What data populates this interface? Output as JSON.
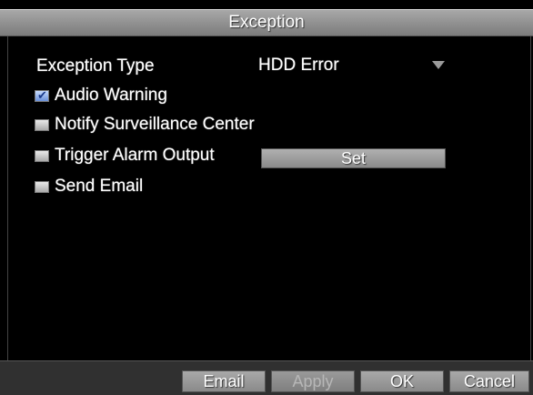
{
  "window": {
    "title": "Exception"
  },
  "exception_type": {
    "label": "Exception Type",
    "value": "HDD Error"
  },
  "checkboxes": [
    {
      "label": "Audio Warning",
      "checked": true
    },
    {
      "label": "Notify Surveillance Center",
      "checked": false
    },
    {
      "label": "Trigger Alarm Output",
      "checked": false
    },
    {
      "label": "Send Email",
      "checked": false
    }
  ],
  "set_button": {
    "label": "Set"
  },
  "footer": {
    "email_label": "Email",
    "apply_label": "Apply",
    "ok_label": "OK",
    "cancel_label": "Cancel"
  },
  "colors": {
    "title_bar": "#8d8d8d",
    "background": "#000000",
    "text": "#ffffff"
  },
  "icons": {
    "dropdown": "chevron-down-icon",
    "checkbox_check": "checkmark-icon"
  }
}
